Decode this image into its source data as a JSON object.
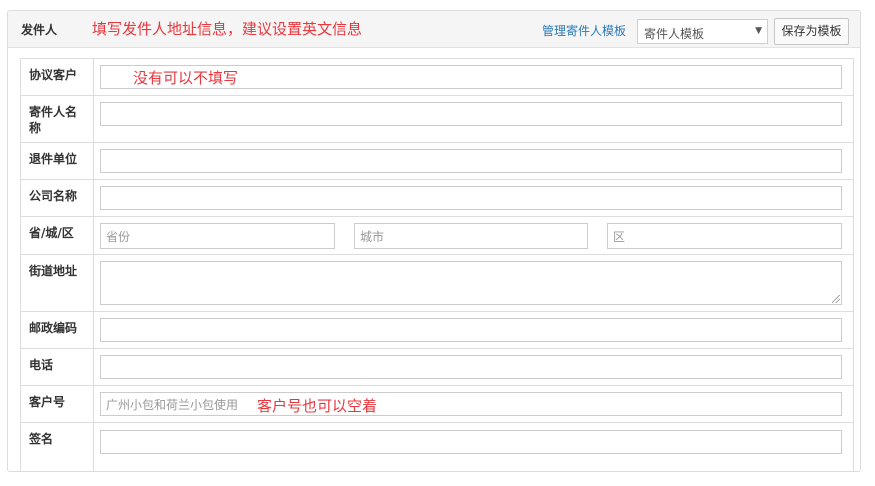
{
  "panel": {
    "title": "发件人",
    "note": "填写发件人地址信息，建议设置英文信息",
    "manage_link": "管理寄件人模板",
    "template_select": {
      "value": "寄件人模板"
    },
    "save_button": "保存为模板"
  },
  "form": {
    "agreement_customer": {
      "label": "协议客户",
      "value": "",
      "note": "没有可以不填写"
    },
    "sender_name": {
      "label": "寄件人名称",
      "value": ""
    },
    "return_unit": {
      "label": "退件单位",
      "value": ""
    },
    "company_name": {
      "label": "公司名称",
      "value": ""
    },
    "region": {
      "label": "省/城/区",
      "province_placeholder": "省份",
      "city_placeholder": "城市",
      "district_placeholder": "区"
    },
    "street_address": {
      "label": "街道地址",
      "value": ""
    },
    "postal_code": {
      "label": "邮政编码",
      "value": ""
    },
    "phone": {
      "label": "电话",
      "value": ""
    },
    "customer_number": {
      "label": "客户号",
      "placeholder": "广州小包和荷兰小包使用",
      "note": "客户号也可以空着"
    },
    "signature": {
      "label": "签名",
      "value": ""
    }
  },
  "colors": {
    "note_red": "#e8373d",
    "link_blue": "#2a7ab8"
  }
}
